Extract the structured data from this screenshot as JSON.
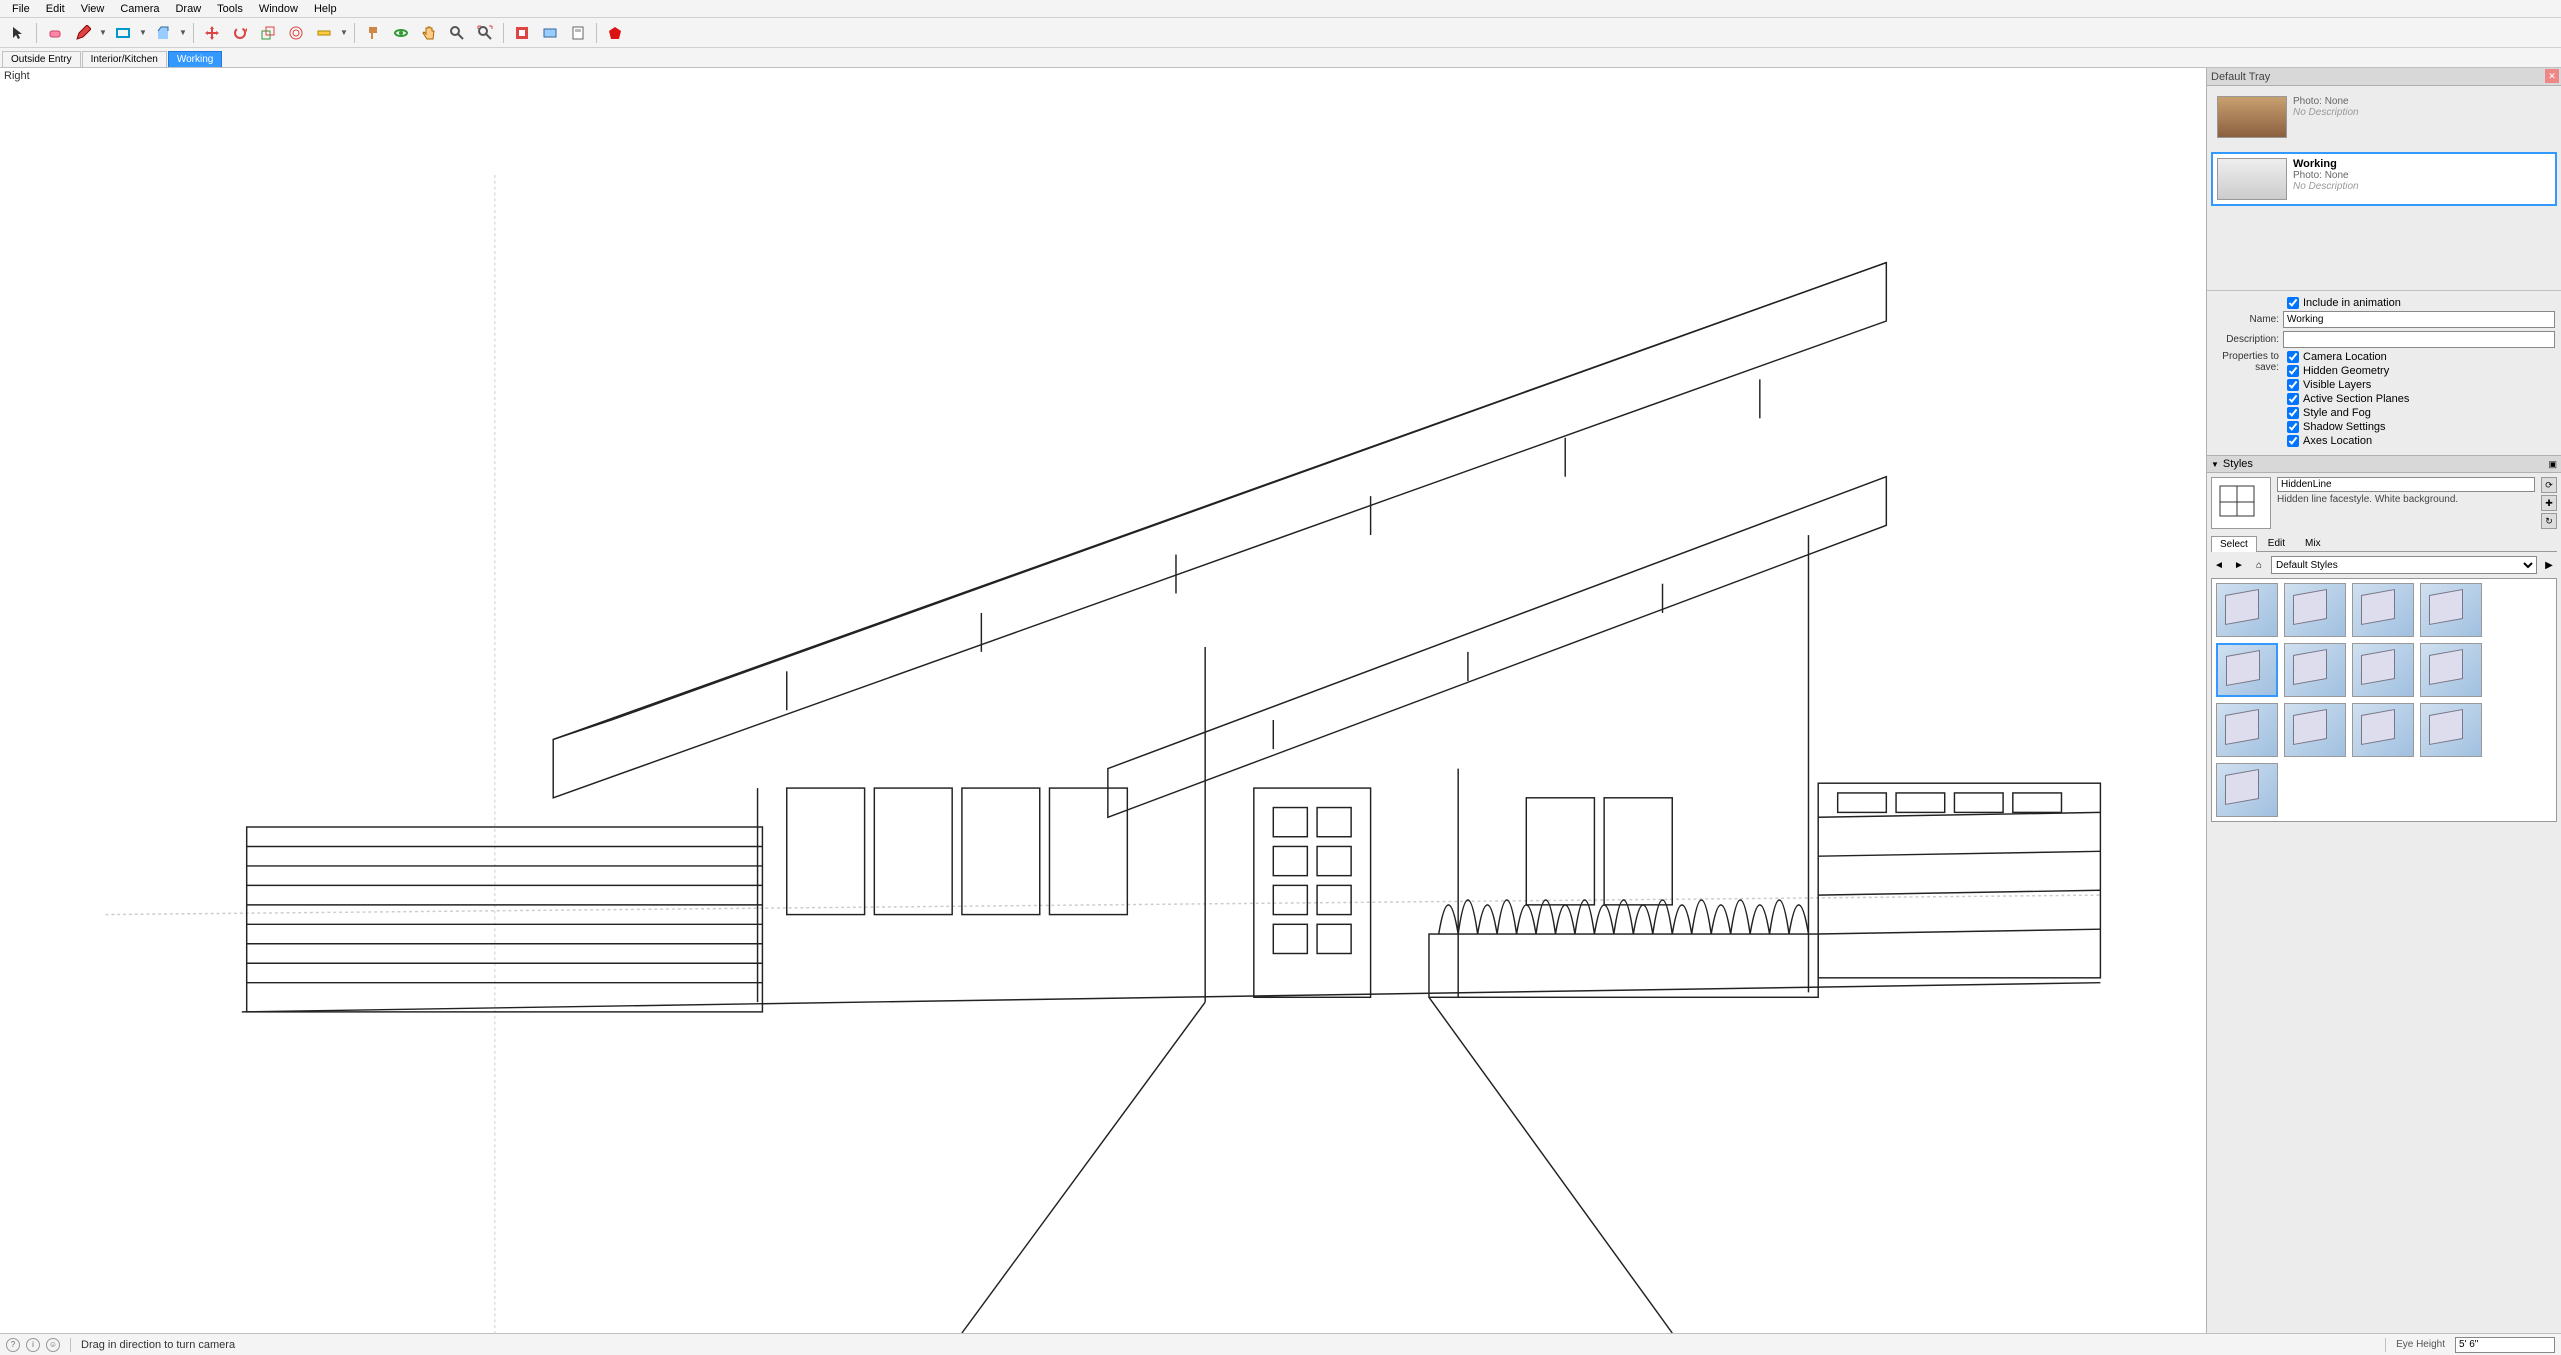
{
  "menu": [
    "File",
    "Edit",
    "View",
    "Camera",
    "Draw",
    "Tools",
    "Window",
    "Help"
  ],
  "scenes": {
    "tabs": [
      "Outside Entry",
      "Interior/Kitchen",
      "Working"
    ],
    "active": 2
  },
  "viewport": {
    "label": "Right"
  },
  "tray": {
    "title": "Default Tray",
    "cards": [
      {
        "name": "",
        "photo": "Photo: None",
        "desc": "No Description",
        "selected": false
      },
      {
        "name": "Working",
        "photo": "Photo: None",
        "desc": "No Description",
        "selected": true
      }
    ],
    "include_label": "Include in animation",
    "name_label": "Name:",
    "name_value": "Working",
    "desc_label": "Description:",
    "desc_value": "",
    "props_label": "Properties to save:",
    "props": [
      "Camera Location",
      "Hidden Geometry",
      "Visible Layers",
      "Active Section Planes",
      "Style and Fog",
      "Shadow Settings",
      "Axes Location"
    ]
  },
  "styles": {
    "panel_title": "Styles",
    "current_name": "HiddenLine",
    "current_desc": "Hidden line facestyle. White background.",
    "tabs": [
      "Select",
      "Edit",
      "Mix"
    ],
    "active_tab": 0,
    "collection": "Default Styles",
    "swatch_count": 13,
    "selected_swatch": 4
  },
  "status": {
    "hint": "Drag in direction to turn camera",
    "vcb_label": "Eye Height",
    "vcb_value": "5' 6\""
  }
}
